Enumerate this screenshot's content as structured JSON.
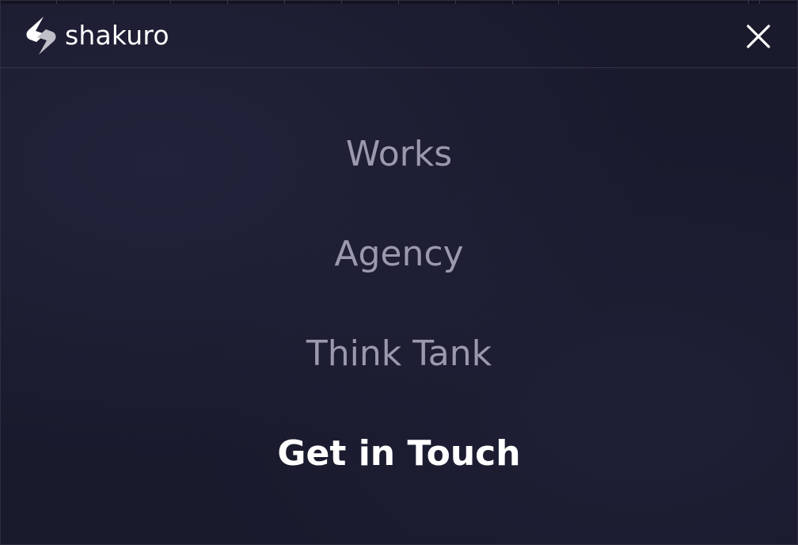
{
  "brand": {
    "name": "shakuro",
    "logo_icon": "shakuro-logo-icon"
  },
  "header": {
    "close_icon": "close-icon"
  },
  "menu": {
    "items": [
      {
        "label": "Works",
        "active": false
      },
      {
        "label": "Agency",
        "active": false
      },
      {
        "label": "Think Tank",
        "active": false
      },
      {
        "label": "Get in Touch",
        "active": true
      }
    ]
  },
  "colors": {
    "background": "#1a1a2d",
    "menu_text": "#9b99ad",
    "menu_text_active": "#ffffff",
    "divider": "#34334a"
  }
}
